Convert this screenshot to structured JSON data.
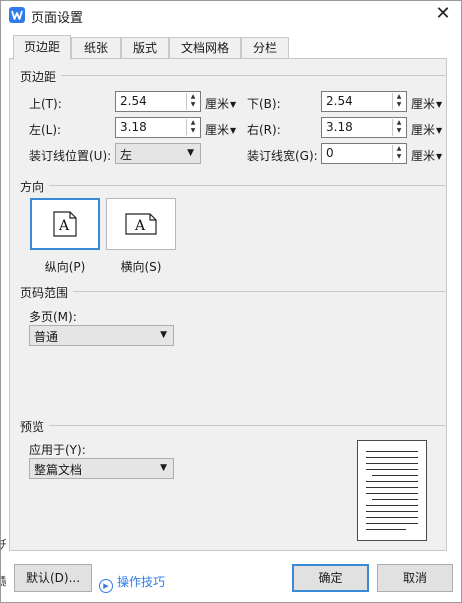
{
  "window": {
    "title": "页面设置"
  },
  "tabs": [
    {
      "label": "页边距",
      "active": true
    },
    {
      "label": "纸张"
    },
    {
      "label": "版式"
    },
    {
      "label": "文档网格"
    },
    {
      "label": "分栏"
    }
  ],
  "margins": {
    "section": "页边距",
    "top_label": "上(T):",
    "top_value": "2.54",
    "bottom_label": "下(B):",
    "bottom_value": "2.54",
    "left_label": "左(L):",
    "left_value": "3.18",
    "right_label": "右(R):",
    "right_value": "3.18",
    "gutter_pos_label": "装订线位置(U):",
    "gutter_pos_value": "左",
    "gutter_width_label": "装订线宽(G):",
    "gutter_width_value": "0",
    "unit": "厘米"
  },
  "orientation": {
    "section": "方向",
    "portrait_label": "纵向(P)",
    "landscape_label": "横向(S)",
    "glyph": "A",
    "selected": "portrait"
  },
  "pages": {
    "section": "页码范围",
    "multi_label": "多页(M):",
    "multi_value": "普通"
  },
  "preview": {
    "section": "预览",
    "apply_label": "应用于(Y):",
    "apply_value": "整篇文档"
  },
  "footer": {
    "default_label": "默认(D)...",
    "tips_label": "操作技巧",
    "ok_label": "确定",
    "cancel_label": "取消"
  },
  "edge_glyphs": [
    "升",
    "慧"
  ],
  "colors": {
    "accent": "#3b8ad6",
    "link": "#2f7ce8",
    "panel": "#f0f0f0"
  }
}
